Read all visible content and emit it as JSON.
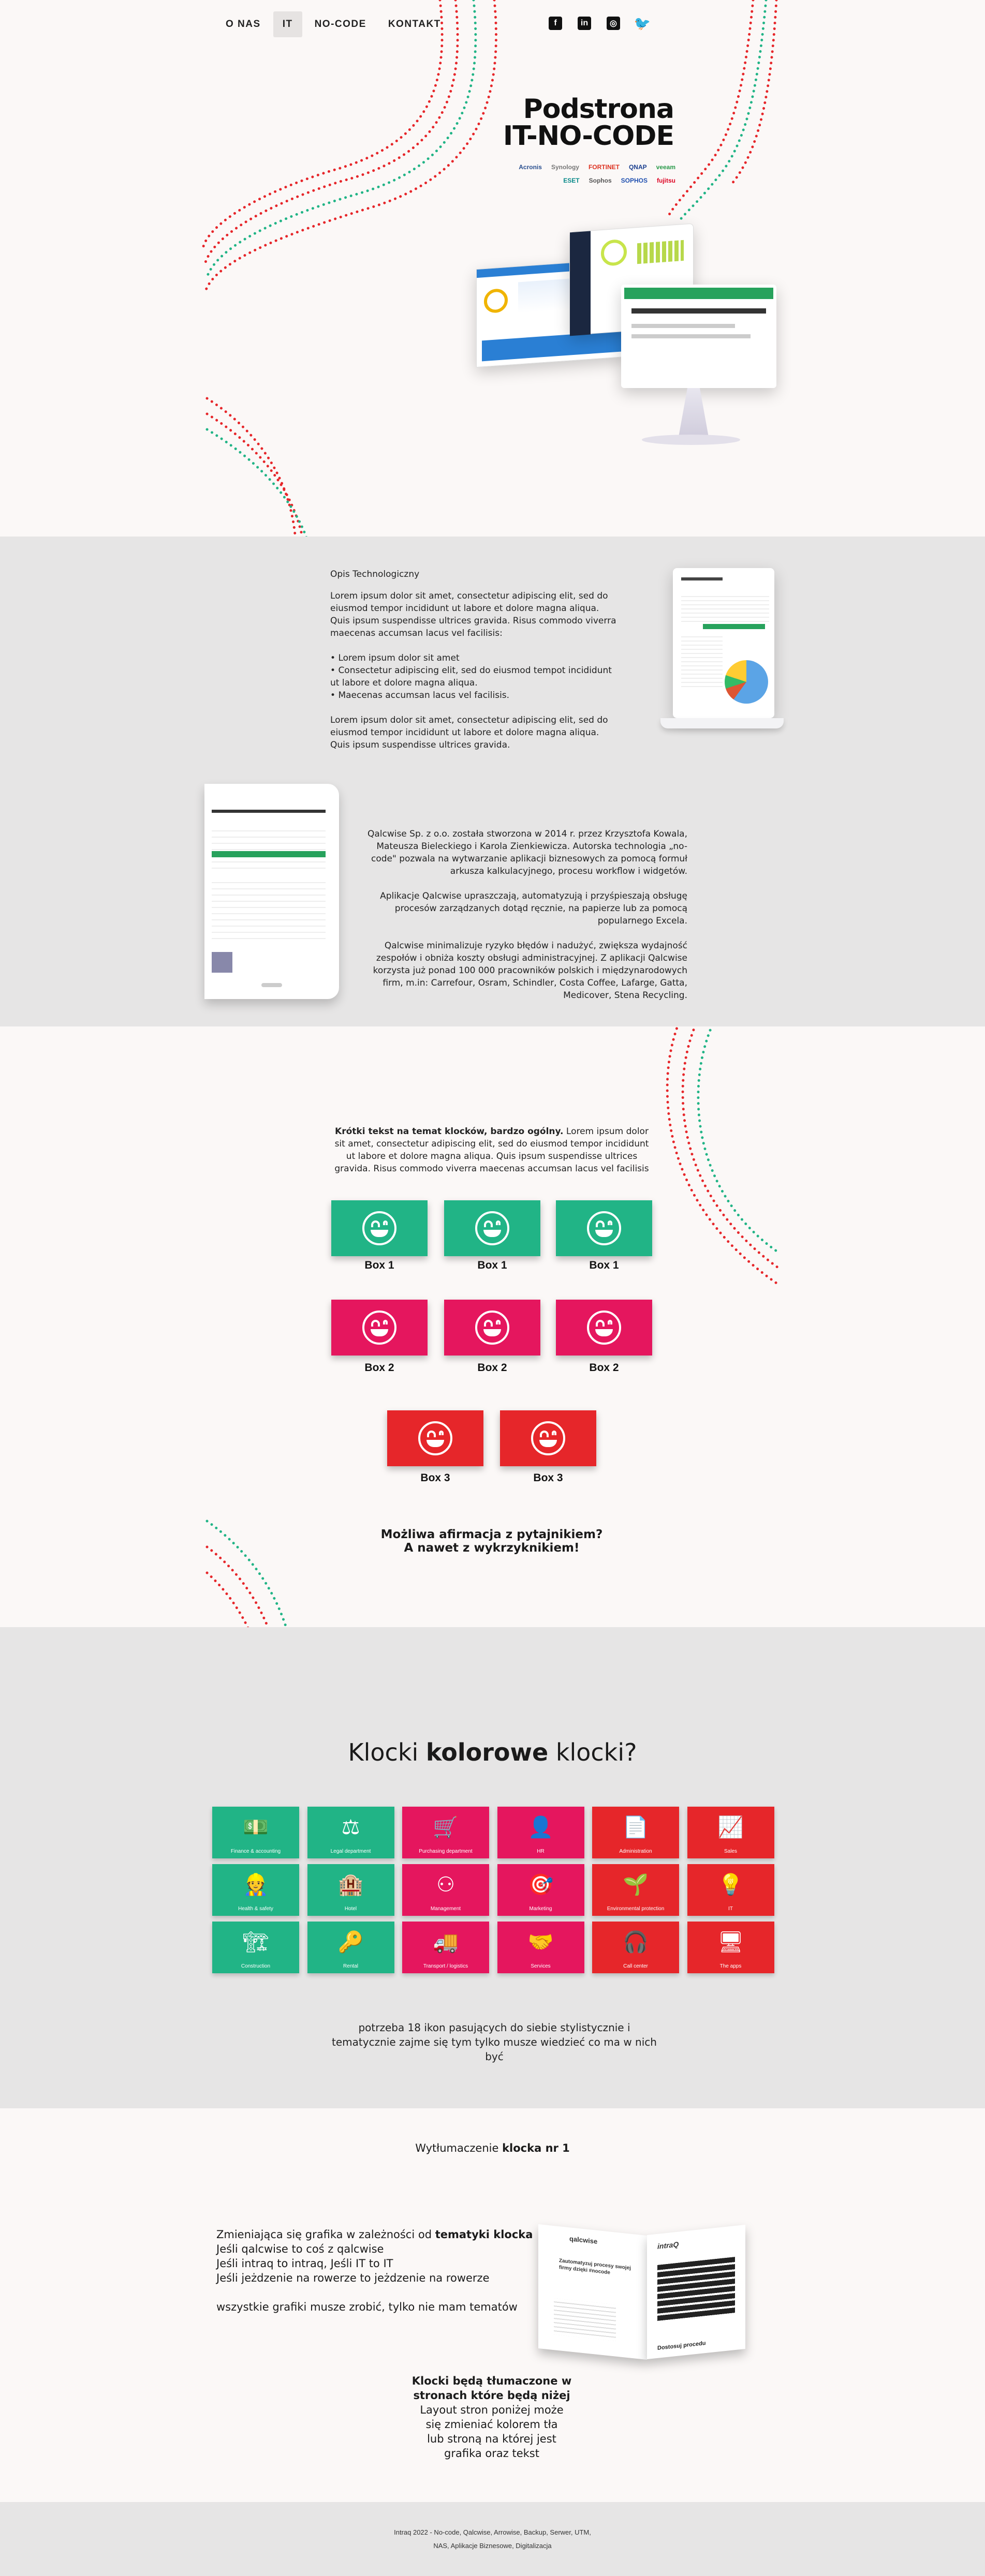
{
  "nav": {
    "items": [
      "O NAS",
      "IT",
      "NO-CODE",
      "KONTAKT"
    ],
    "active": "IT"
  },
  "social": [
    "facebook-icon",
    "linkedin-icon",
    "instagram-icon",
    "twitter-icon"
  ],
  "hero": {
    "title_line1": "Podstrona",
    "title_line2": "IT-NO-CODE",
    "logos": [
      "Acronis",
      "Synology",
      "FORTINET",
      "QNAP",
      "veeam",
      "ESET",
      "Sophos",
      "SOPHOS",
      "fujitsu"
    ]
  },
  "opis": {
    "heading": "Opis Technologiczny",
    "para1": "Lorem ipsum dolor sit amet, consectetur adipiscing elit, sed do eiusmod tempor incididunt ut labore et dolore magna aliqua. Quis ipsum suspendisse ultrices gravida. Risus commodo viverra maecenas accumsan lacus vel facilisis:",
    "bullets": [
      "Lorem ipsum dolor sit amet",
      "Consectetur adipiscing elit, sed do eiusmod tempot incididunt ut labore et dolore magna aliqua.",
      "Maecenas accumsan lacus vel facilisis."
    ],
    "para2": "Lorem ipsum dolor sit amet, consectetur adipiscing elit, sed do eiusmod tempor incididunt ut labore et dolore magna aliqua. Quis ipsum suspendisse ultrices gravida."
  },
  "qalcwise": {
    "para1": "Qalcwise Sp. z o.o. została stworzona w 2014 r. przez Krzysztofa Kowala, Mateusza Bieleckiego i Karola Zienkiewicza. Autorska technologia „no-code\" pozwala na wytwarzanie aplikacji biznesowych za pomocą formuł arkusza kalkulacyjnego, procesu workflow i widgetów.",
    "para2": "Aplikacje Qalcwise upraszczają, automatyzują i przyśpieszają obsługę procesów zarządzanych dotąd ręcznie, na papierze lub za pomocą popularnego Excela.",
    "para3": "Qalcwise minimalizuje ryzyko błędów i nadużyć, zwiększa wydajność zespołów i obniża koszty obsługi administracyjnej.  Z aplikacji Qalcwise korzysta już ponad 100 000 pracowników polskich i międzynarodowych firm, m.in: Carrefour, Osram, Schindler, Costa Coffee, Lafarge, Gatta, Medicover, Stena Recycling."
  },
  "klocki": {
    "intro_bold": "Krótki tekst na temat klocków, bardzo ogólny.",
    "intro_rest": " Lorem ipsum dolor sit amet, consectetur adipiscing elit, sed do eiusmod tempor incididunt ut labore et dolore magna aliqua. Quis ipsum suspendisse ultrices gravida. Risus commodo viverra maecenas accumsan lacus vel facilisis",
    "box1": "Box 1",
    "box2": "Box 2",
    "box3": "Box 3",
    "afirmacja1": "Możliwa afirmacja z pytajnikiem?",
    "afirmacja2": "A nawet z wykrzyknikiem!"
  },
  "kolorowe": {
    "title_pre": "Klocki ",
    "title_bold": "kolorowe",
    "title_post": " klocki?",
    "tiles": [
      {
        "label": "Finance & accounting",
        "icon": "money-icon",
        "glyph": "💵",
        "color": "#21b486"
      },
      {
        "label": "Legal department",
        "icon": "scales-icon",
        "glyph": "⚖",
        "color": "#21b486"
      },
      {
        "label": "Purchasing department",
        "icon": "cart-icon",
        "glyph": "🛒",
        "color": "#e5165e"
      },
      {
        "label": "HR",
        "icon": "person-icon",
        "glyph": "👤",
        "color": "#e5165e"
      },
      {
        "label": "Administration",
        "icon": "document-icon",
        "glyph": "📄",
        "color": "#e6262a"
      },
      {
        "label": "Sales",
        "icon": "sales-chart-icon",
        "glyph": "📈",
        "color": "#e6262a"
      },
      {
        "label": "Health & safety",
        "icon": "worker-icon",
        "glyph": "👷",
        "color": "#21b486"
      },
      {
        "label": "Hotel",
        "icon": "building-icon",
        "glyph": "🏨",
        "color": "#21b486"
      },
      {
        "label": "Management",
        "icon": "hierarchy-icon",
        "glyph": "⚇",
        "color": "#e5165e"
      },
      {
        "label": "Marketing",
        "icon": "target-icon",
        "glyph": "🎯",
        "color": "#e5165e"
      },
      {
        "label": "Environmental protection",
        "icon": "leaf-hand-icon",
        "glyph": "🌱",
        "color": "#e6262a"
      },
      {
        "label": "IT",
        "icon": "lightbulb-icon",
        "glyph": "💡",
        "color": "#e6262a"
      },
      {
        "label": "Construction",
        "icon": "crane-icon",
        "glyph": "🏗",
        "color": "#21b486"
      },
      {
        "label": "Rental",
        "icon": "key-icon",
        "glyph": "🔑",
        "color": "#21b486"
      },
      {
        "label": "Transport / logistics",
        "icon": "truck-icon",
        "glyph": "🚚",
        "color": "#e5165e"
      },
      {
        "label": "Services",
        "icon": "handshake-icon",
        "glyph": "🤝",
        "color": "#e5165e"
      },
      {
        "label": "Call center",
        "icon": "headset-icon",
        "glyph": "🎧",
        "color": "#e6262a"
      },
      {
        "label": "The apps",
        "icon": "monitor-icon",
        "glyph": "🖥",
        "color": "#e6262a"
      }
    ],
    "note": "potrzeba 18 ikon pasujących do siebie stylistycznie i tematycznie zajme się tym tylko musze wiedzieć co ma w nich być"
  },
  "wytlumaczenie": {
    "title_pre": "Wytłumaczenie ",
    "title_bold": "klocka nr 1",
    "line1_pre": "Zmieniająca się grafika w zależności od ",
    "line1_bold": "tematyki klocka",
    "line2": "Jeśli qalcwise to coś z qalcwise",
    "line3": "Jeśli intraq to intraq, Jeśli IT to IT",
    "line4": "Jeśli jeżdzenie na rowerze to jeżdzenie na rowerze",
    "line5": "wszystkie grafiki musze zrobić, tylko nie mam tematów",
    "bold1": "Klocki będą tłumaczone w",
    "bold2": "stronach które będą niżej",
    "rest1": "Layout stron poniżej może",
    "rest2": "się zmieniać kolorem tła",
    "rest3": "lub stroną na której jest",
    "rest4": "grafika oraz tekst",
    "card_qalcwise": "qalcwise",
    "card_intraq": "intraQ",
    "card_heading": "Zautomatyzuj procesy swojej firmy dzięki #nocode",
    "card_cta": "Dostosuj procedu"
  },
  "footer": {
    "line1": "Intraq 2022 - No-code, Qalcwise, Arrowise, Backup, Serwer, UTM,",
    "line2": "NAS, Aplikacje Biznesowe, Digitalizacja"
  },
  "colors": {
    "green": "#21b486",
    "pink": "#e5165e",
    "red": "#e6262a",
    "grey": "#e6e5e5"
  }
}
